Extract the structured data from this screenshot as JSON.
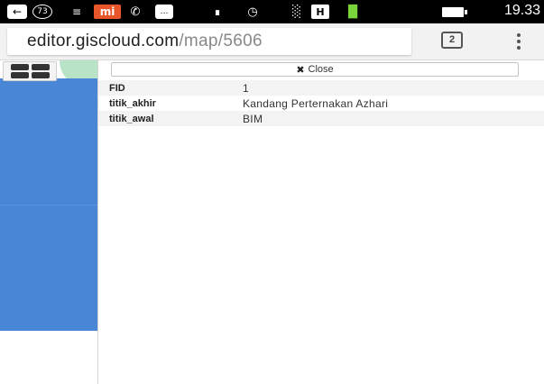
{
  "status_bar": {
    "time": "19.33",
    "notification_count": "73",
    "icons": [
      "back-icon",
      "notification-badge-icon",
      "apps-icon",
      "mi-icon",
      "phone-icon",
      "chat-icon",
      "vibrate-icon",
      "alarm-icon",
      "signal-icon",
      "h-network-icon",
      "signal-2-icon",
      "battery-icon"
    ],
    "mi_label": "mi",
    "h_label": "H"
  },
  "browser": {
    "url_domain": "editor.giscloud.com",
    "url_path": "/map/5606",
    "tab_count": "2"
  },
  "map": {
    "colors": {
      "water": "#4a86d6",
      "land": "#b9e3c6"
    }
  },
  "panel": {
    "close_label": "Close",
    "attributes": [
      {
        "key": "FID",
        "value": "1"
      },
      {
        "key": "titik_akhir",
        "value": "Kandang Perternakan Azhari"
      },
      {
        "key": "titik_awal",
        "value": "BIM"
      }
    ]
  }
}
